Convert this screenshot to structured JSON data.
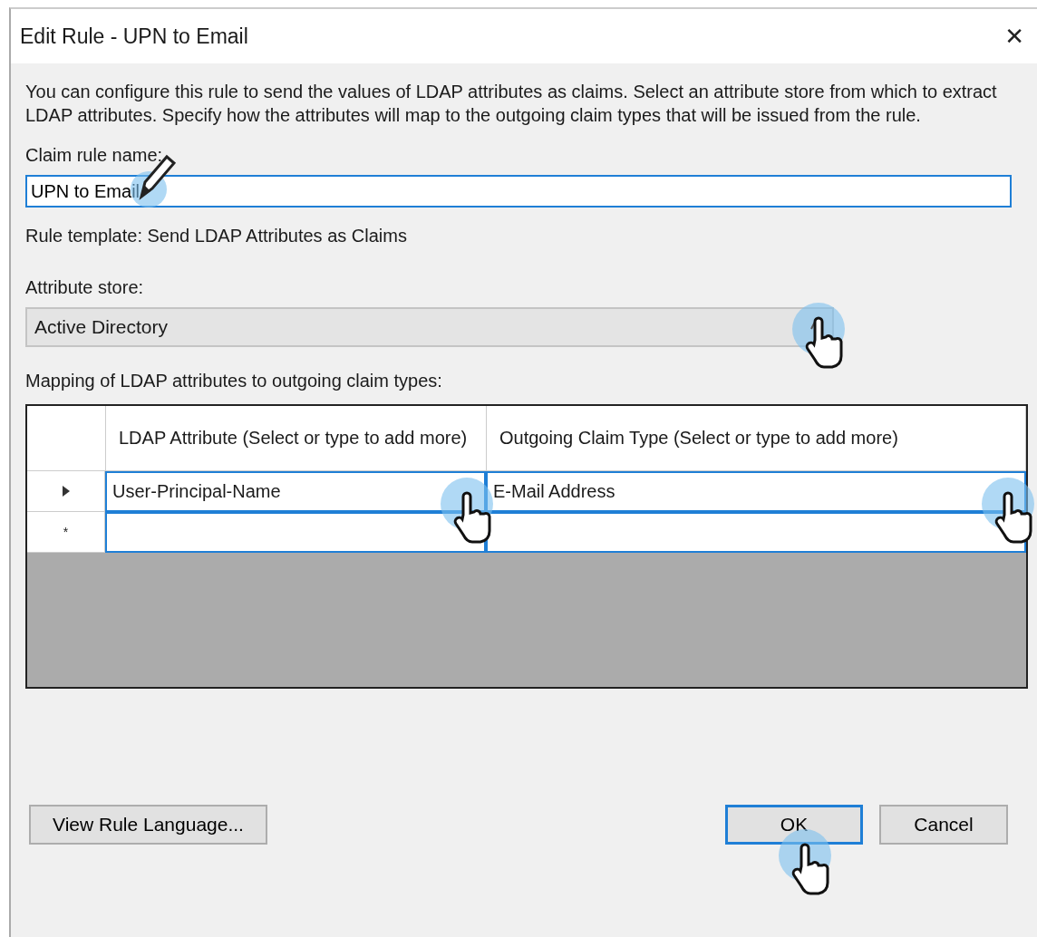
{
  "window": {
    "title": "Edit Rule - UPN to Email",
    "close": "✕"
  },
  "description": "You can configure this rule to send the values of LDAP attributes as claims. Select an attribute store from which to extract LDAP attributes. Specify how the attributes will map to the outgoing claim types that will be issued from the rule.",
  "name_field": {
    "label": "Claim rule name:",
    "value": "UPN to Email"
  },
  "template": "Rule template: Send LDAP Attributes as Claims",
  "attribute_store": {
    "label": "Attribute store:",
    "value": "Active Directory"
  },
  "mapping": {
    "label": "Mapping of LDAP attributes to outgoing claim types:",
    "columns": [
      "LDAP Attribute (Select or type to add more)",
      "Outgoing Claim Type (Select or type to add more)"
    ],
    "rows": [
      {
        "kind": "current",
        "cells": [
          "User-Principal-Name",
          "E-Mail Address"
        ]
      },
      {
        "kind": "new",
        "marker": "*"
      }
    ]
  },
  "buttons": [
    {
      "label": "View Rule Language...",
      "default": false
    },
    {
      "label": "OK",
      "default": true
    },
    {
      "label": "Cancel",
      "default": false
    }
  ]
}
